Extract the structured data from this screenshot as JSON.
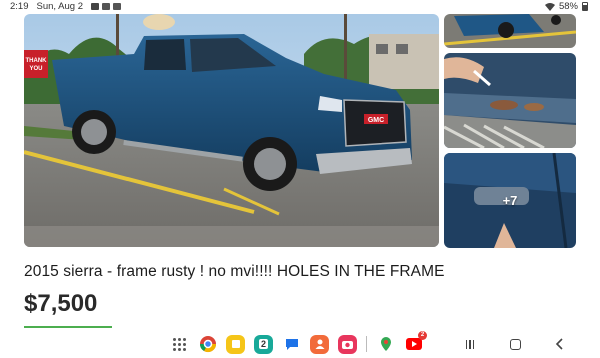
{
  "status_bar": {
    "time": "2:19",
    "date": "Sun, Aug 2",
    "battery": "58%",
    "icons": [
      "gallery-icon",
      "youtube-icon",
      "youtube-icon"
    ]
  },
  "gallery": {
    "more_photos_label": "+7",
    "sign_text": "THANK YOU"
  },
  "listing": {
    "title": "2015 sierra - frame rusty ! no mvi!!!! HOLES IN THE FRAME",
    "price": "$7,500"
  },
  "dock": {
    "apps": [
      {
        "name": "apps-grid-icon"
      },
      {
        "name": "chrome-icon"
      },
      {
        "name": "notes-icon"
      },
      {
        "name": "calendar-icon",
        "label": "2"
      },
      {
        "name": "messages-icon"
      },
      {
        "name": "contacts-icon"
      },
      {
        "name": "camera-icon"
      },
      {
        "name": "maps-icon"
      },
      {
        "name": "youtube-icon",
        "badge": "2"
      }
    ]
  },
  "colors": {
    "accent_green": "#4cae4f",
    "truck_blue": "#1d4f7a"
  }
}
